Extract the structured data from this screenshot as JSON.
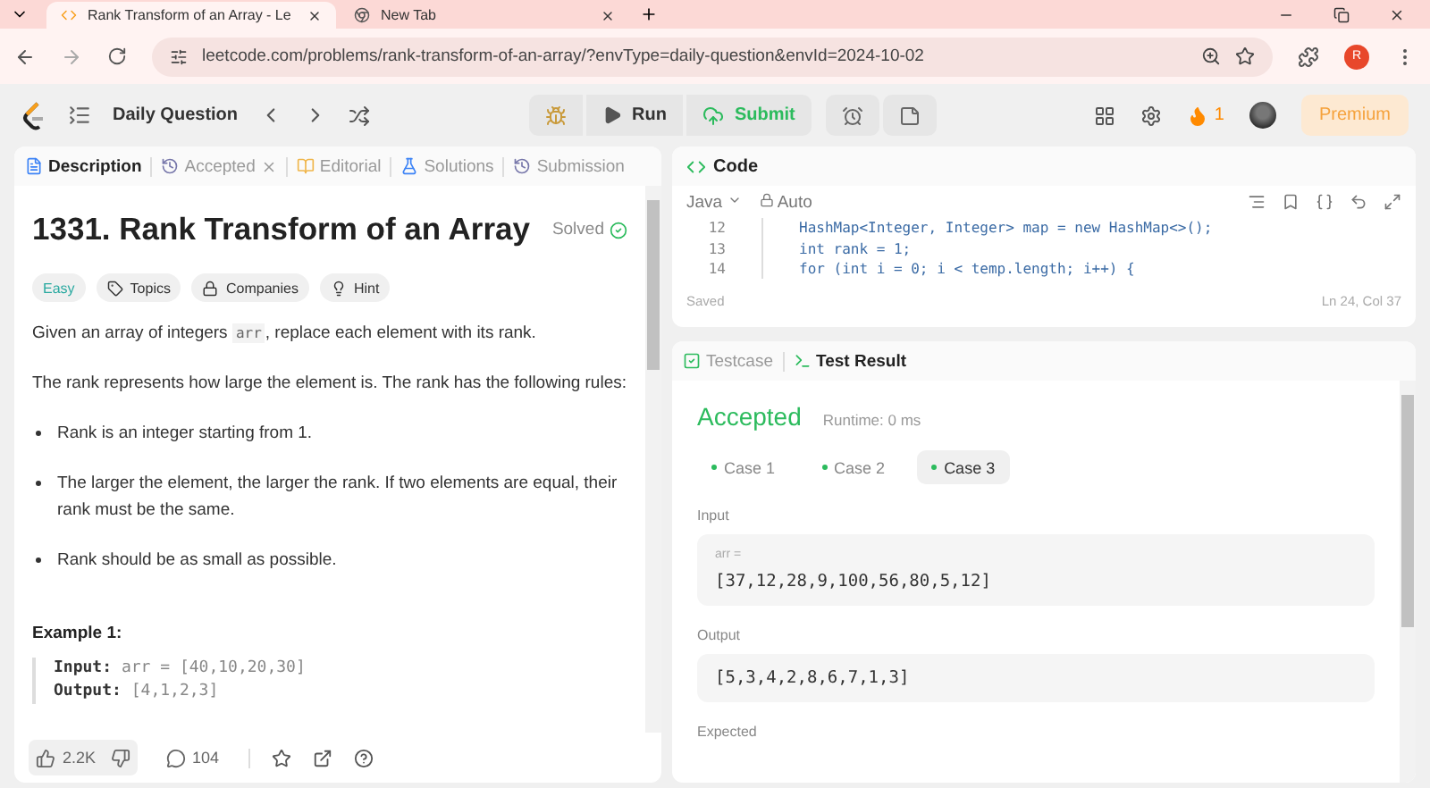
{
  "browser": {
    "tabs": [
      {
        "title": "Rank Transform of an Array - Le",
        "selected": true,
        "kind": "site"
      },
      {
        "title": "New Tab",
        "selected": false,
        "kind": "chrome"
      }
    ],
    "address": "leetcode.com/problems/rank-transform-of-an-array/?envType=daily-question&envId=2024-10-02",
    "profile_initial": "R"
  },
  "nav": {
    "title": "Daily Question",
    "run": "Run",
    "submit": "Submit",
    "streak": "1",
    "premium": "Premium"
  },
  "description": {
    "tabs": [
      {
        "label": "Description",
        "selected": true,
        "closable": false,
        "kind": "doc"
      },
      {
        "label": "Accepted",
        "selected": false,
        "closable": true,
        "kind": "history"
      },
      {
        "label": "Editorial",
        "selected": false,
        "closable": false,
        "kind": "book"
      },
      {
        "label": "Solutions",
        "selected": false,
        "closable": false,
        "kind": "flask"
      },
      {
        "label": "Submission",
        "selected": false,
        "closable": false,
        "kind": "history"
      }
    ],
    "title": "1331. Rank Transform of an Array",
    "status": "Solved",
    "tags": [
      {
        "label": "Easy",
        "kind": "difficulty"
      },
      {
        "label": "Topics",
        "kind": "topics"
      },
      {
        "label": "Companies",
        "kind": "companies"
      },
      {
        "label": "Hint",
        "kind": "hint"
      }
    ],
    "intro": {
      "before": "Given an array of integers ",
      "code": "arr",
      "after": ", replace each element with its rank."
    },
    "paragraph": "The rank represents how large the element is. The rank has the following rules:",
    "rules": [
      "Rank is an integer starting from 1.",
      "The larger the element, the larger the rank. If two elements are equal, their rank must be the same.",
      "Rank should be as small as possible."
    ],
    "example_title": "Example 1:",
    "example_lines": [
      {
        "label": "Input:",
        "value": "arr = [40,10,20,30]"
      },
      {
        "label": "Output:",
        "value": "[4,1,2,3]"
      }
    ],
    "likes": "2.2K",
    "comments": "104"
  },
  "code": {
    "title": "Code",
    "language": "Java",
    "mode": "Auto",
    "lines": [
      {
        "number": "12",
        "text": "HashMap<Integer, Integer> map = new HashMap<>();"
      },
      {
        "number": "13",
        "text": "int rank = 1;"
      },
      {
        "number": "14",
        "text": "for (int i = 0; i < temp.length; i++) {"
      }
    ],
    "status": "Saved",
    "position": "Ln 24, Col 37"
  },
  "result": {
    "tabs": [
      {
        "label": "Testcase",
        "selected": false,
        "kind": "check"
      },
      {
        "label": "Test Result",
        "selected": true,
        "kind": "terminal"
      }
    ],
    "verdict": "Accepted",
    "runtime": "Runtime: 0 ms",
    "cases": [
      {
        "label": "Case 1",
        "selected": false
      },
      {
        "label": "Case 2",
        "selected": false
      },
      {
        "label": "Case 3",
        "selected": true
      }
    ],
    "input_label": "Input",
    "input_var": "arr =",
    "input_value": "[37,12,28,9,100,56,80,5,12]",
    "output_label": "Output",
    "output_value": "[5,3,4,2,8,6,7,1,3]",
    "expected_label": "Expected"
  }
}
